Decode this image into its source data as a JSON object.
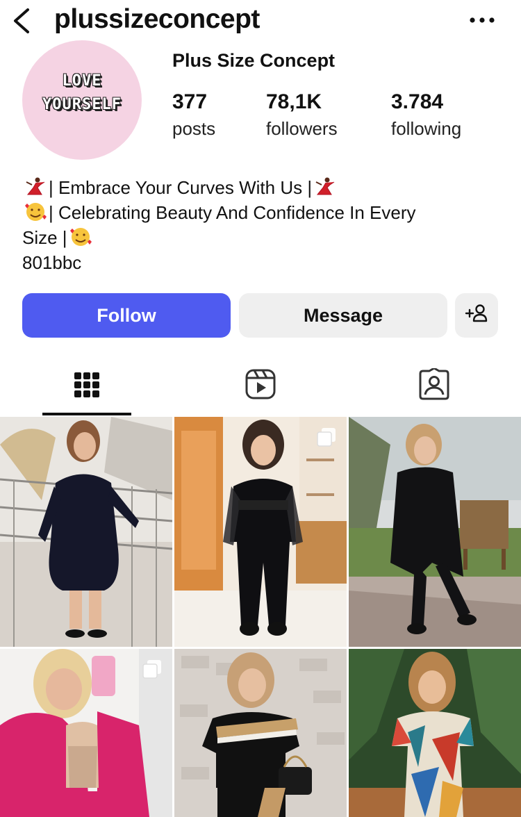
{
  "header": {
    "username": "plussizeconcept",
    "back_icon": "chevron-left-icon",
    "more_icon": "more-horizontal-icon"
  },
  "profile": {
    "avatar_line1": "LOVE",
    "avatar_line2": "YOURSELF",
    "display_name": "Plus Size Concept",
    "stats": [
      {
        "value": "377",
        "label": "posts"
      },
      {
        "value": "78,1K",
        "label": "followers"
      },
      {
        "value": "3.784",
        "label": "following"
      }
    ],
    "bio": {
      "line1": "| Embrace Your Curves With Us |",
      "line2": "| Celebrating Beauty And Confidence In Every",
      "line3": "Size |",
      "line4": "801bbc",
      "emojis": [
        "dancer-emoji",
        "smiling-face-with-hearts-emoji"
      ]
    }
  },
  "actions": {
    "follow_label": "Follow",
    "message_label": "Message",
    "add_user_icon": "add-user-icon"
  },
  "tabs": [
    {
      "name": "posts-grid",
      "icon": "grid-icon",
      "active": true
    },
    {
      "name": "reels",
      "icon": "reels-icon",
      "active": false
    },
    {
      "name": "tagged",
      "icon": "tagged-user-icon",
      "active": false
    }
  ],
  "colors": {
    "follow_button": "#4f5bf0",
    "secondary_button": "#efefef",
    "avatar_bg": "#f5d3e3"
  },
  "posts": [
    {
      "id": "post-1",
      "multi": false
    },
    {
      "id": "post-2",
      "multi": true
    },
    {
      "id": "post-3",
      "multi": false
    },
    {
      "id": "post-4",
      "multi": true
    },
    {
      "id": "post-5",
      "multi": false
    },
    {
      "id": "post-6",
      "multi": false
    }
  ]
}
